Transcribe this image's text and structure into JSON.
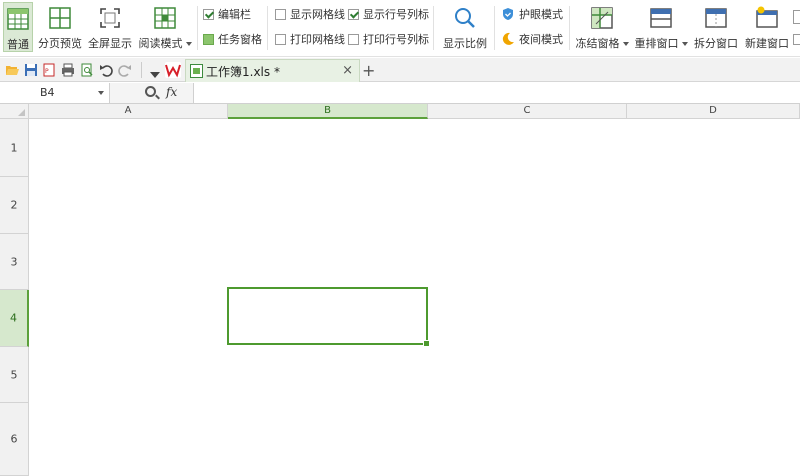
{
  "ribbon": {
    "normal": "普通",
    "page_break_preview": "分页预览",
    "full_screen": "全屏显示",
    "reading_mode": "阅读模式",
    "edit_bar": "编辑栏",
    "task_pane": "任务窗格",
    "show_gridlines": "显示网格线",
    "print_gridlines": "打印网格线",
    "show_row_col_headers": "显示行号列标",
    "print_row_col_headers": "打印行号列标",
    "zoom": "显示比例",
    "eye_protection": "护眼模式",
    "night_mode": "夜间模式",
    "freeze_panes": "冻结窗格",
    "arrange_windows": "重排窗口",
    "split_window": "拆分窗口",
    "new_window": "新建窗口",
    "checked": {
      "edit_bar": true,
      "show_gridlines": false,
      "show_row_col_headers": true,
      "print_gridlines": false,
      "print_row_col_headers": false
    }
  },
  "tabs": {
    "document_name": "工作簿1.xls *",
    "close": "×",
    "new_tab": "+"
  },
  "formula_bar": {
    "name_box": "B4",
    "fx": "fx",
    "content": ""
  },
  "sheet": {
    "columns": [
      "A",
      "B",
      "C",
      "D"
    ],
    "rows": [
      "1",
      "2",
      "3",
      "4",
      "5",
      "6"
    ],
    "selected_cell": "B4"
  },
  "colors": {
    "accent_green": "#4d9a2f",
    "header_selected": "#d6e8cd",
    "header_bg": "#f1f1f1"
  }
}
